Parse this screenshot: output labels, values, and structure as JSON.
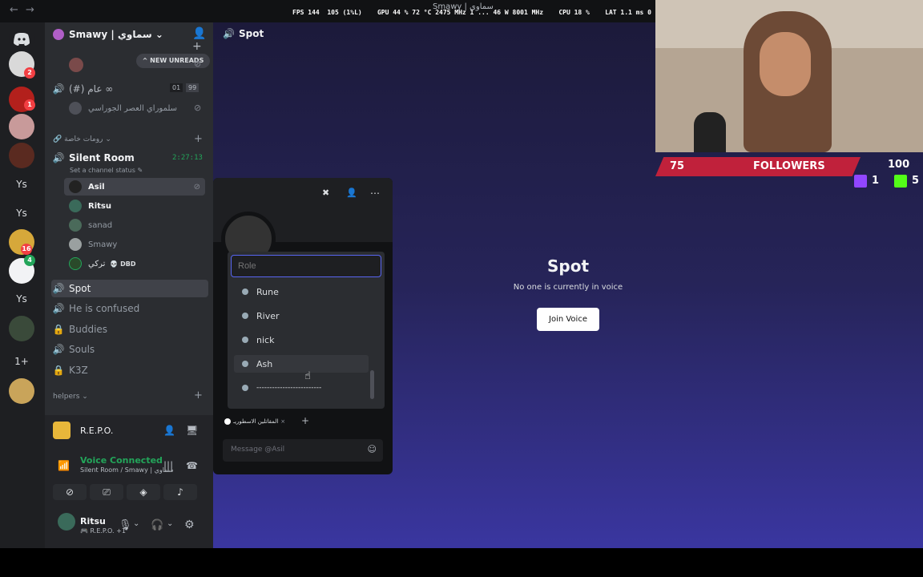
{
  "stats": {
    "overlay": "FPS 144  105 (1%L)    GPU 44 % 72 °C 2475 MHz 1 ... 46 W 8001 MHz    CPU 18 %    LAT 1.1 ms 0 ms",
    "window_title": "Smawy | سماوي"
  },
  "guilds": [
    {
      "name": "discord-home",
      "badge": ""
    },
    {
      "name": "guild-1",
      "badge": "2"
    },
    {
      "name": "guild-2",
      "badge": "1"
    },
    {
      "name": "guild-3",
      "badge": ""
    },
    {
      "name": "guild-4",
      "badge": ""
    },
    {
      "name": "guild-ys-1",
      "text": "Ys"
    },
    {
      "name": "guild-ys-2",
      "text": "Ys"
    },
    {
      "name": "guild-5",
      "badge": "16"
    },
    {
      "name": "guild-6",
      "badge": "4"
    },
    {
      "name": "guild-ys-3",
      "text": "Ys"
    },
    {
      "name": "guild-7",
      "badge": ""
    },
    {
      "name": "guild-1plus",
      "text": "1+"
    },
    {
      "name": "guild-8",
      "badge": ""
    }
  ],
  "server": {
    "name": "Smawy | سماوي",
    "new_unreads": "NEW UNREADS",
    "channel_row_1": "(#) عام ∞",
    "channel_row_1_count_a": "01",
    "channel_row_1_count_b": "99",
    "channel_row_1_user": "سلموراي العصر الجوراسي",
    "category_private": "رومات خاصة",
    "silent_room": "Silent Room",
    "silent_time": "2:27:13",
    "channel_status": "Set a channel status",
    "voice_users": [
      "Asil",
      "Ritsu",
      "sanad",
      "Smawy",
      "تركي"
    ],
    "dbd": "DBD",
    "spot": "Spot",
    "confused": "He is confused",
    "buddies": "Buddies",
    "souls": "Souls",
    "k3z": "K3Z",
    "helpers": "helpers"
  },
  "activity": {
    "name": "R.E.P.O."
  },
  "voice": {
    "status": "Voice Connected",
    "location": "Silent Room / Smawy | سماوي"
  },
  "user": {
    "name": "Ritsu",
    "activity": "R.E.P.O. +1"
  },
  "main": {
    "title": "Spot",
    "big_title": "Spot",
    "subtitle": "No one is currently in voice",
    "join_button": "Join Voice"
  },
  "popup": {
    "role_placeholder": "Role",
    "roles": [
      "Rune",
      "River",
      "nick",
      "Ash",
      "-------------------------"
    ],
    "tag": "المقاتلين الاسطوريـ",
    "message_placeholder": "Message @Asil"
  },
  "stream": {
    "followers_count": "75",
    "followers_label": "FOLLOWERS",
    "followers_goal": "100",
    "twitch_count": "1",
    "kick_count": "5"
  },
  "colors": {
    "accent": "#5865f2",
    "green": "#23a55a",
    "followers_bar": "#c0213b"
  }
}
